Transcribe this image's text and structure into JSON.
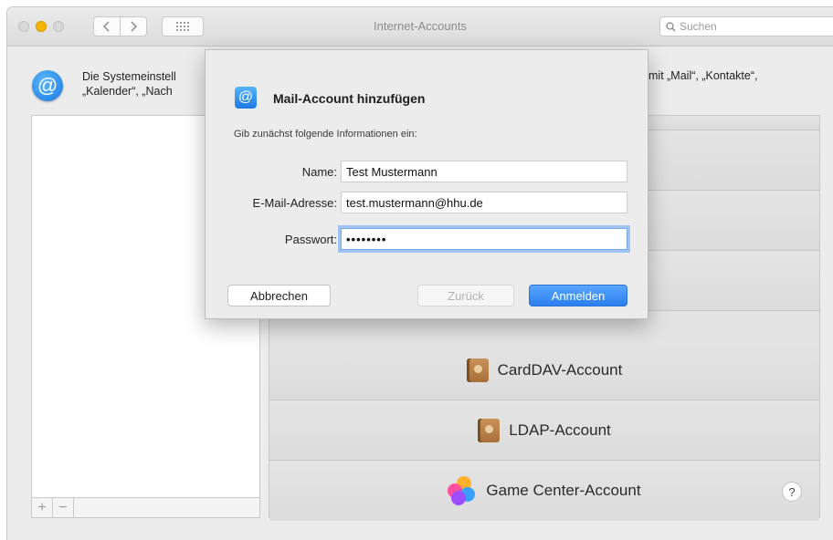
{
  "window": {
    "title": "Internet-Accounts",
    "search_placeholder": "Suchen"
  },
  "header": {
    "text_line1": "Die Systemeinstell",
    "text_line2": "„Kalender“, „Nach",
    "text_right": "mit „Mail“, „Kontakte“,"
  },
  "sidebar": {
    "add_label": "+",
    "remove_label": "−"
  },
  "providers": [
    {
      "label": "CardDAV-Account",
      "icon": "contacts-icon"
    },
    {
      "label": "LDAP-Account",
      "icon": "contacts-icon"
    },
    {
      "label": "Game Center-Account",
      "icon": "game-center-icon"
    }
  ],
  "help_label": "?",
  "dialog": {
    "title": "Mail-Account hinzufügen",
    "subtitle": "Gib zunächst folgende Informationen ein:",
    "fields": {
      "name_label": "Name:",
      "name_value": "Test Mustermann",
      "email_label": "E-Mail-Adresse:",
      "email_value": "test.mustermann@hhu.de",
      "password_label": "Passwort:",
      "password_value": "••••••••"
    },
    "buttons": {
      "cancel": "Abbrechen",
      "back": "Zurück",
      "login": "Anmelden"
    }
  },
  "colors": {
    "accent": "#2b7fee",
    "focus_ring": "#9ec4f3",
    "minimize": "#f4b400"
  }
}
